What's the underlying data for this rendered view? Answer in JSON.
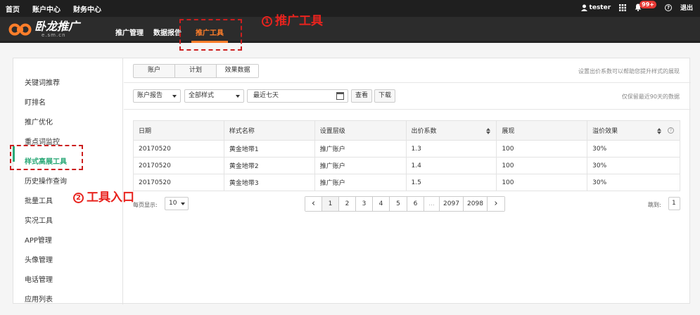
{
  "topbar": {
    "nav": [
      "首页",
      "账户中心",
      "财务中心"
    ],
    "username": "tester",
    "badge": "99+",
    "help_glyph": "?",
    "logout": "退出"
  },
  "header": {
    "logo_cn": "卧龙推广",
    "logo_en": "e.sm.cn",
    "menu": [
      "推广管理",
      "数据报告",
      "推广工具"
    ],
    "active_menu_index": 2
  },
  "annotations": {
    "one_num": "1",
    "one_text": "推广工具",
    "two_num": "2",
    "two_text": "工具入口",
    "color": "#e8231e"
  },
  "sidebar": {
    "items": [
      "关键词推荐",
      "盯排名",
      "推广优化",
      "重点词监控",
      "样式高展工具",
      "历史操作查询",
      "批量工具",
      "实况工具",
      "APP管理",
      "头像管理",
      "电话管理",
      "应用列表"
    ],
    "active_index": 4
  },
  "tabs": [
    "账户",
    "计划",
    "效果数据"
  ],
  "hint_top": "设置出价系数可以帮助您提升样式的展现",
  "filters": {
    "report": "账户报告",
    "style": "全部样式",
    "date": "最近七天",
    "view_button": "查看",
    "download_button": "下载",
    "hint": "仅保留最近90天的数据"
  },
  "table": {
    "headers": [
      "日期",
      "样式名称",
      "设置层级",
      "出价系数",
      "展现",
      "溢价效果"
    ],
    "help_glyph": "?",
    "rows": [
      [
        "20170520",
        "黄金地带1",
        "推广账户",
        "1.3",
        "100",
        "30%"
      ],
      [
        "20170520",
        "黄金地带2",
        "推广账户",
        "1.4",
        "100",
        "30%"
      ],
      [
        "20170520",
        "黄金地带3",
        "推广账户",
        "1.5",
        "100",
        "30%"
      ]
    ]
  },
  "pagination": {
    "per_page_label": "每页显示:",
    "per_page_value": "10",
    "prev": "‹",
    "pages": [
      "1",
      "2",
      "3",
      "4",
      "5",
      "6",
      "...",
      "2097",
      "2098"
    ],
    "next": "›",
    "current": "1",
    "jump_label": "跳到:",
    "jump_value": "1"
  },
  "colors": {
    "accent_orange": "#ff7e2a",
    "active_green": "#2aa876",
    "topbar_bg": "#1f1f1f"
  }
}
